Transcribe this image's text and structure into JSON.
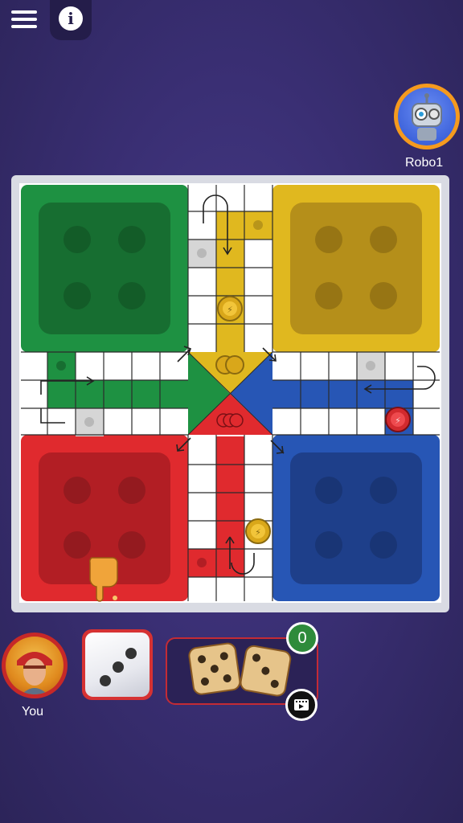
{
  "header": {
    "menu_icon": "hamburger-menu-icon",
    "info_icon": "info-icon",
    "info_glyph": "i"
  },
  "players": {
    "opponent": {
      "name": "Robo1",
      "avatar": "robot-avatar",
      "ring_color": "#f59a1e"
    },
    "self": {
      "name": "You",
      "avatar": "player-avatar",
      "ring_color": "#c62828"
    }
  },
  "board": {
    "colors": {
      "green": "#1e9142",
      "yellow": "#e0b81f",
      "red": "#e02a2e",
      "blue": "#2756b5"
    },
    "tokens_on_board": [
      {
        "color": "yellow",
        "count": 1
      },
      {
        "color": "yellow",
        "count": 2
      },
      {
        "color": "red",
        "count": 3
      },
      {
        "color": "yellow",
        "count": 1
      },
      {
        "color": "red",
        "count": 1
      }
    ]
  },
  "controls": {
    "dice_value": 3,
    "bonus_dice_count": "0",
    "video_icon": "video-ad-icon",
    "pointer_icon": "pointing-hand-icon"
  }
}
